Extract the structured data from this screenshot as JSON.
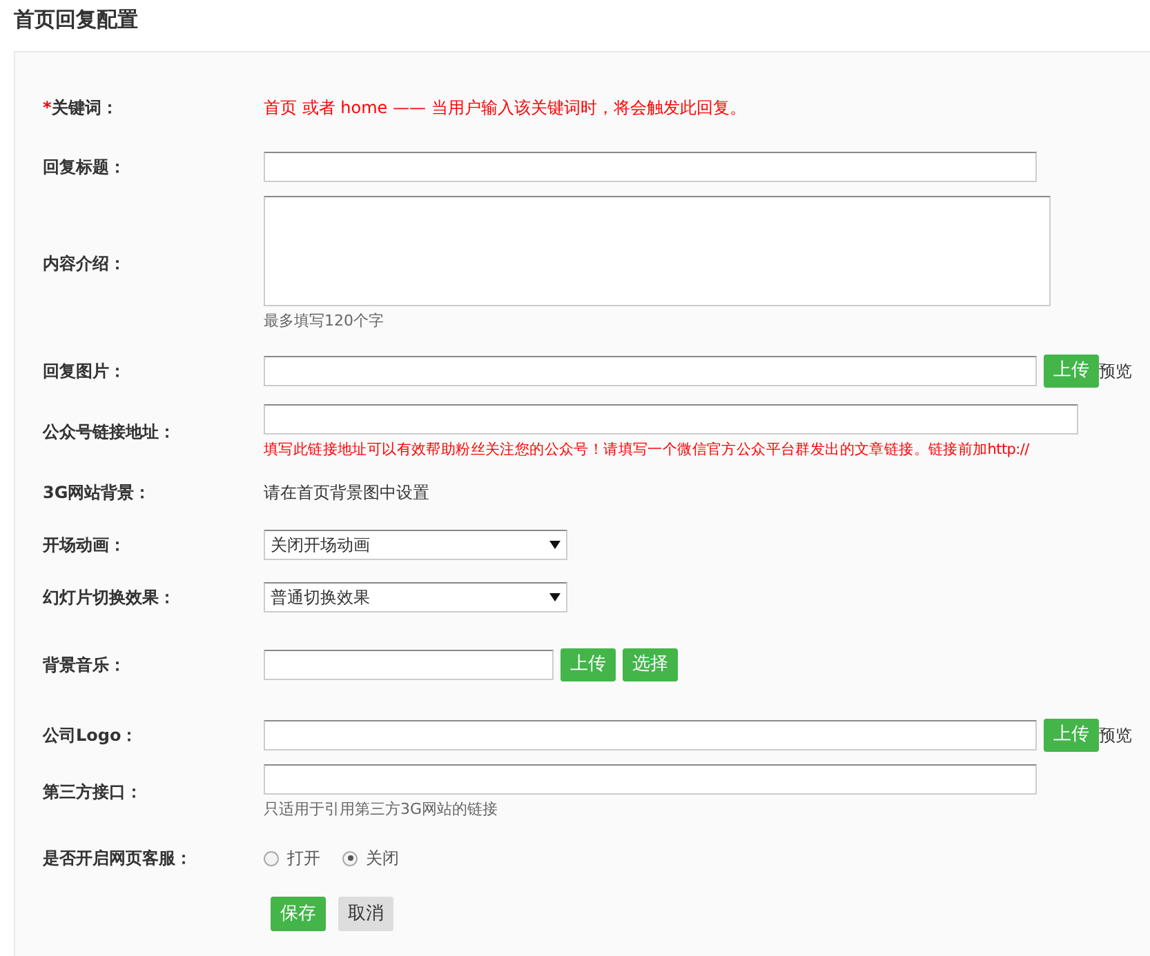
{
  "page_title": "首页回复配置",
  "rows": [
    {
      "kind": "note",
      "marker": "*",
      "label": "关键词：",
      "text": "首页 或者 home —— 当用户输入该关键词时，将会触发此回复。"
    },
    {
      "kind": "text",
      "label": "回复标题："
    },
    {
      "kind": "textarea",
      "label": "内容介绍：",
      "hint": "最多填写120个字"
    },
    {
      "kind": "upload",
      "label": "回复图片：",
      "buttons": [
        "上传"
      ],
      "link": "预览"
    },
    {
      "kind": "long-text",
      "label": "公众号链接地址：",
      "warning": "填写此链接地址可以有效帮助粉丝关注您的公众号！请填写一个微信官方公众平台群发出的文章链接。链接前加http://"
    },
    {
      "kind": "static",
      "label": "3G网站背景：",
      "text": "请在首页背景图中设置"
    },
    {
      "kind": "select",
      "label": "开场动画：",
      "value": "关闭开场动画"
    },
    {
      "kind": "select",
      "label": "幻灯片切换效果：",
      "value": "普通切换效果"
    },
    {
      "kind": "music",
      "label": "背景音乐：",
      "buttons": [
        "上传",
        "选择"
      ]
    },
    {
      "kind": "upload",
      "label": "公司Logo：",
      "buttons": [
        "上传"
      ],
      "link": "预览"
    },
    {
      "kind": "text",
      "label": "第三方接口：",
      "hint": "只适用于引用第三方3G网站的链接"
    },
    {
      "kind": "radio",
      "label": "是否开启网页客服：",
      "options": [
        {
          "label": "打开",
          "selected": false
        },
        {
          "label": "关闭",
          "selected": true
        }
      ]
    }
  ],
  "actions": [
    {
      "label": "保存",
      "kind": "primary"
    },
    {
      "label": "取消",
      "kind": "secondary"
    }
  ]
}
